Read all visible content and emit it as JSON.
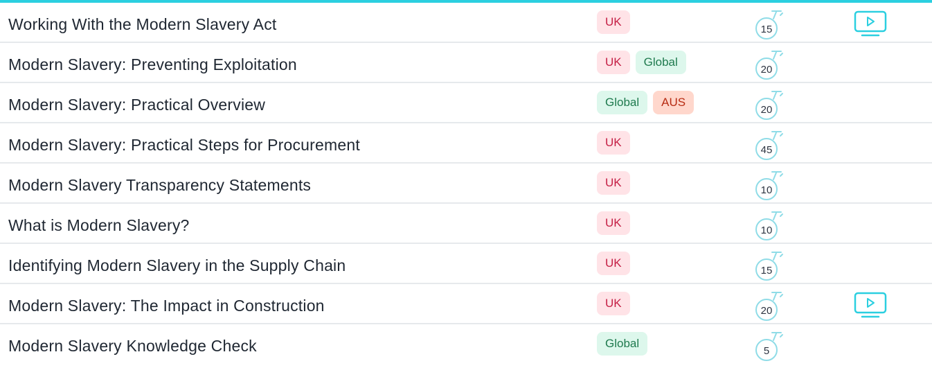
{
  "accent_color": "#2bcfe0",
  "tag_colors": {
    "UK": "#ffe3e7",
    "Global": "#ddf7ec",
    "AUS": "#ffd7cc"
  },
  "icons": {
    "timer": "stopwatch-icon",
    "video": "video-play-icon"
  },
  "courses": [
    {
      "title": "Working With the Modern Slavery Act",
      "tags": [
        "UK"
      ],
      "minutes": "15",
      "video": true
    },
    {
      "title": "Modern Slavery: Preventing Exploitation",
      "tags": [
        "UK",
        "Global"
      ],
      "minutes": "20",
      "video": false
    },
    {
      "title": "Modern Slavery: Practical Overview",
      "tags": [
        "Global",
        "AUS"
      ],
      "minutes": "20",
      "video": false
    },
    {
      "title": "Modern Slavery: Practical Steps for Procurement",
      "tags": [
        "UK"
      ],
      "minutes": "45",
      "video": false
    },
    {
      "title": "Modern Slavery Transparency Statements",
      "tags": [
        "UK"
      ],
      "minutes": "10",
      "video": false
    },
    {
      "title": "What is Modern Slavery?",
      "tags": [
        "UK"
      ],
      "minutes": "10",
      "video": false
    },
    {
      "title": "Identifying Modern Slavery in the Supply Chain",
      "tags": [
        "UK"
      ],
      "minutes": "15",
      "video": false
    },
    {
      "title": "Modern Slavery: The Impact in Construction",
      "tags": [
        "UK"
      ],
      "minutes": "20",
      "video": true
    },
    {
      "title": "Modern Slavery Knowledge Check",
      "tags": [
        "Global"
      ],
      "minutes": "5",
      "video": false
    }
  ]
}
